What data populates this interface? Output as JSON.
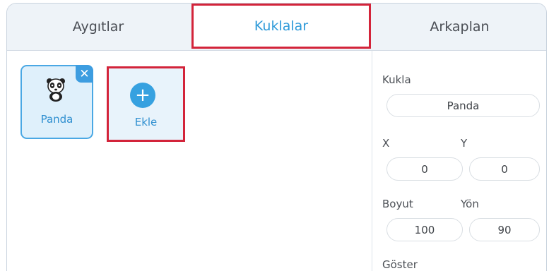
{
  "tabs": {
    "devices": "Aygıtlar",
    "sprites": "Kuklalar",
    "backdrops": "Arkaplan"
  },
  "sprites": {
    "items": [
      {
        "name": "Panda",
        "icon": "panda-icon"
      }
    ],
    "add_label": "Ekle"
  },
  "properties": {
    "sprite_label": "Kukla",
    "sprite_value": "Panda",
    "x_label": "X",
    "x_value": "0",
    "y_label": "Y",
    "y_value": "0",
    "size_label": "Boyut",
    "size_value": "100",
    "direction_label": "Yön",
    "direction_value": "90",
    "show_label": "Göster"
  },
  "colors": {
    "accent": "#3d9de0",
    "highlight": "#d3243a",
    "selected_card_bg": "#dff0fb"
  }
}
